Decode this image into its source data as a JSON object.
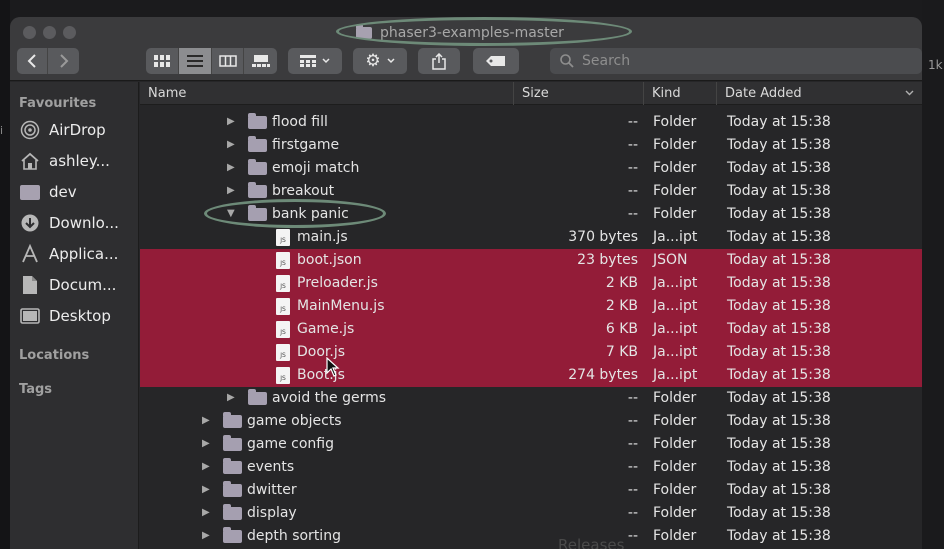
{
  "window": {
    "title": "phaser3-examples-master"
  },
  "toolbar": {
    "back_icon": "chevron-left-icon",
    "forward_icon": "chevron-right-icon",
    "view_modes": [
      "icon-view-icon",
      "list-view-icon",
      "column-view-icon",
      "gallery-view-icon"
    ],
    "search_placeholder": "Search"
  },
  "background": {
    "right_fragment": "1k"
  },
  "sidebar": {
    "favourites_heading": "Favourites",
    "items": [
      {
        "label": "AirDrop",
        "icon": "airdrop-icon"
      },
      {
        "label": "ashley...",
        "icon": "home-icon"
      },
      {
        "label": "dev",
        "icon": "folder-icon"
      },
      {
        "label": "Downlo...",
        "icon": "downloads-icon"
      },
      {
        "label": "Applica...",
        "icon": "applications-icon"
      },
      {
        "label": "Docum...",
        "icon": "document-icon"
      },
      {
        "label": "Desktop",
        "icon": "desktop-icon"
      }
    ],
    "locations_heading": "Locations",
    "tags_heading": "Tags"
  },
  "columns": {
    "name": "Name",
    "size": "Size",
    "kind": "Kind",
    "date_added": "Date Added"
  },
  "rows": [
    {
      "name": "flood fill",
      "size": "--",
      "kind": "Folder",
      "date": "Today at 15:38"
    },
    {
      "name": "firstgame",
      "size": "--",
      "kind": "Folder",
      "date": "Today at 15:38"
    },
    {
      "name": "emoji match",
      "size": "--",
      "kind": "Folder",
      "date": "Today at 15:38"
    },
    {
      "name": "breakout",
      "size": "--",
      "kind": "Folder",
      "date": "Today at 15:38"
    },
    {
      "name": "bank panic",
      "size": "--",
      "kind": "Folder",
      "date": "Today at 15:38"
    },
    {
      "name": "main.js",
      "size": "370 bytes",
      "kind": "Ja...ipt",
      "date": "Today at 15:38"
    },
    {
      "name": "boot.json",
      "size": "23 bytes",
      "kind": "JSON",
      "date": "Today at 15:38"
    },
    {
      "name": "Preloader.js",
      "size": "2 KB",
      "kind": "Ja...ipt",
      "date": "Today at 15:38"
    },
    {
      "name": "MainMenu.js",
      "size": "2 KB",
      "kind": "Ja...ipt",
      "date": "Today at 15:38"
    },
    {
      "name": "Game.js",
      "size": "6 KB",
      "kind": "Ja...ipt",
      "date": "Today at 15:38"
    },
    {
      "name": "Door.js",
      "size": "7 KB",
      "kind": "Ja...ipt",
      "date": "Today at 15:38"
    },
    {
      "name": "Boot.js",
      "size": "274 bytes",
      "kind": "Ja...ipt",
      "date": "Today at 15:38"
    },
    {
      "name": "avoid the germs",
      "size": "--",
      "kind": "Folder",
      "date": "Today at 15:38"
    },
    {
      "name": "game objects",
      "size": "--",
      "kind": "Folder",
      "date": "Today at 15:38"
    },
    {
      "name": "game config",
      "size": "--",
      "kind": "Folder",
      "date": "Today at 15:38"
    },
    {
      "name": "events",
      "size": "--",
      "kind": "Folder",
      "date": "Today at 15:38"
    },
    {
      "name": "dwitter",
      "size": "--",
      "kind": "Folder",
      "date": "Today at 15:38"
    },
    {
      "name": "display",
      "size": "--",
      "kind": "Folder",
      "date": "Today at 15:38"
    },
    {
      "name": "depth sorting",
      "size": "--",
      "kind": "Folder",
      "date": "Today at 15:38"
    }
  ],
  "colors": {
    "selection": "#931c38",
    "annotation_ellipse": "#6d8a78"
  },
  "footer_fragment": "Releases"
}
